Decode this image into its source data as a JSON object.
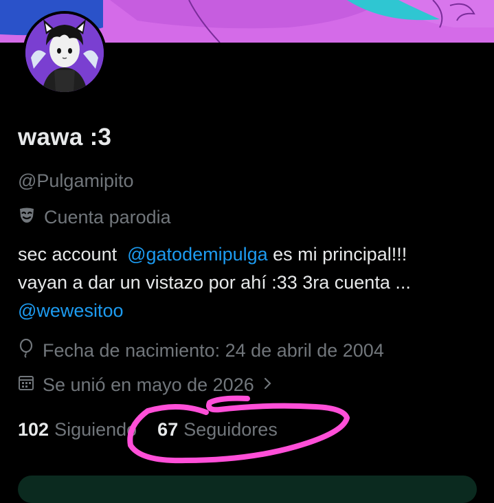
{
  "profile": {
    "display_name": "wawa :3",
    "handle": "@Pulgamipito",
    "label": "Cuenta parodia",
    "bio": {
      "line1_text": "sec account ",
      "line1_mention": "@gatodemipulga",
      "line1_rest": " es mi principal!!!",
      "line2": "vayan a dar un vistazo por ahí :33 3ra cuenta ...",
      "line3_mention": "@wewesitoo"
    },
    "birth": "Fecha de nacimiento: 24 de abril de 2004",
    "joined": "Se unió en mayo de 2026"
  },
  "stats": {
    "following_count": "102",
    "following_label": "Siguiendo",
    "followers_count": "67",
    "followers_label": "Seguidores"
  },
  "colors": {
    "background": "#000000",
    "text_primary": "#e7e9ea",
    "text_secondary": "#71767b",
    "link": "#1d9bf0",
    "banner": "#d46be8",
    "highlight_stroke": "#ff4fd8"
  },
  "icons": {
    "label": "parody-mask-icon",
    "birth": "balloon-icon",
    "joined": "calendar-icon",
    "joined_chevron": "chevron-right-icon"
  }
}
